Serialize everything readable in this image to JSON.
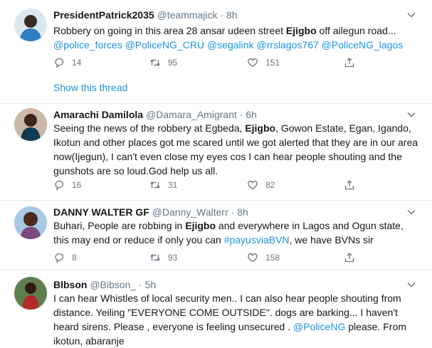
{
  "tweets": [
    {
      "name": "PresidentPatrick2035",
      "handle": "@teammajick",
      "time": "8h",
      "text_1": "Robbery on going in this area 28 ansar udeen street ",
      "bold_1": "Ejigbo",
      "text_2": " off ailegun road...",
      "mentions_line": "@police_forces @PoliceNG_CRU @segalink @rrslagos767 @PoliceNG_lagos",
      "replies": "14",
      "retweets": "95",
      "likes": "151",
      "show_thread": "Show this thread"
    },
    {
      "name": "Amarachi Damilola",
      "handle": "@Damara_Amigrant",
      "time": "6h",
      "text_1": "Seeing the news of the robbery at Egbeda, ",
      "bold_1": "Ejigbo",
      "text_2": ", Gowon Estate, Egan, Igando, Ikotun and other places got me scared until we got alerted that they are in our area now(Ijegun), I can't even close my eyes cos I can hear people shouting and the gunshots are so loud.God help us all.",
      "replies": "16",
      "retweets": "31",
      "likes": "82"
    },
    {
      "name": "DANNY WALTER GF",
      "handle": "@Danny_Walterr",
      "time": "8h",
      "text_1": "Buhari, People are robbing in ",
      "bold_1": "Ejigbo",
      "text_2": " and everywhere in Lagos and Ogun state, this may end or reduce if only you can ",
      "hashtag": "#payusviaBVN",
      "text_3": ", we have BVNs sir",
      "replies": "8",
      "retweets": "93",
      "likes": "158"
    },
    {
      "name": "Blbson",
      "handle": "@Bibson_",
      "time": "5h",
      "text_1": "I can hear Whistles of local security men.. I can also hear people shouting from distance. Yeiling \"EVERYONE COME OUTSIDE\". dogs are barking... I haven't heard sirens. Please , everyone is feeling unsecured . ",
      "mention": "@PoliceNG",
      "text_2": " please. From ikotun, abaranje"
    }
  ],
  "colors": {
    "link": "#1b95e0",
    "muted": "#657786",
    "divider": "#e6ecf0"
  },
  "icons": [
    "reply-icon",
    "retweet-icon",
    "like-icon",
    "share-icon",
    "chevron-down-icon"
  ]
}
